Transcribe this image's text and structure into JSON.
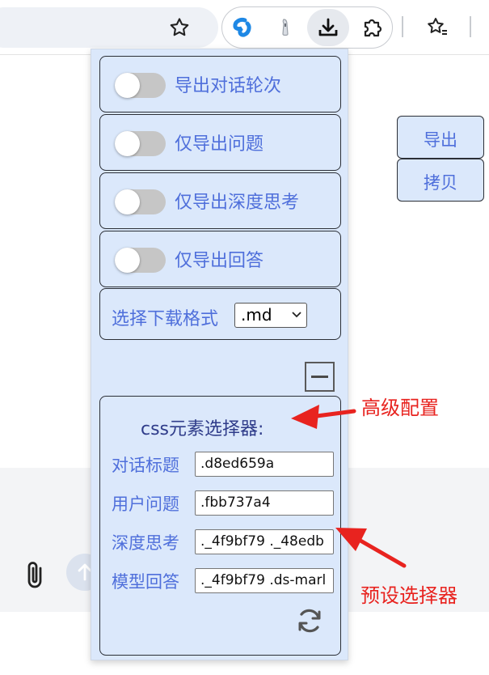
{
  "toolbar": {
    "icons": [
      "bookmark-star-icon",
      "extension-swirl-icon",
      "extension-pen-icon",
      "download-icon",
      "extensions-puzzle-icon",
      "bookmarks-icon"
    ]
  },
  "panel": {
    "toggles": [
      {
        "label": "导出对话轮次",
        "on": false
      },
      {
        "label": "仅导出问题",
        "on": false
      },
      {
        "label": "仅导出深度思考",
        "on": false
      },
      {
        "label": "仅导出回答",
        "on": false
      }
    ],
    "format": {
      "label": "选择下载格式",
      "selected": ".md"
    },
    "advanced": {
      "title": "css元素选择器:",
      "fields": [
        {
          "label": "对话标题",
          "value": ".d8ed659a"
        },
        {
          "label": "用户问题",
          "value": ".fbb737a4"
        },
        {
          "label": "深度思考",
          "value": "._4f9bf79 ._48edb"
        },
        {
          "label": "模型回答",
          "value": "._4f9bf79 .ds-marl"
        }
      ]
    }
  },
  "side_buttons": {
    "export": "导出",
    "copy": "拷贝"
  },
  "annotations": {
    "advanced": "高级配置",
    "preset": "预设选择器"
  },
  "colors": {
    "accent": "#4f6fdb",
    "panel_bg": "#dbe8fb",
    "annotation": "#e8231f"
  }
}
